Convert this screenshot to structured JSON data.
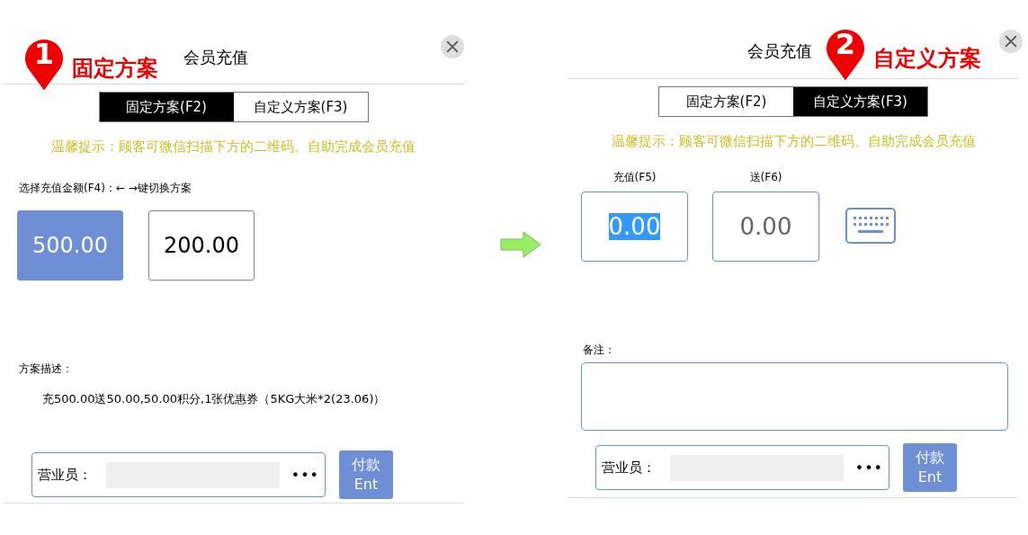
{
  "panels": [
    {
      "kind": "fixed",
      "title": "会员充值",
      "callout": {
        "number": "1",
        "label": "固定方案"
      },
      "tabs": [
        {
          "label": "固定方案(F2)",
          "selected": true
        },
        {
          "label": "自定义方案(F3)",
          "selected": false
        }
      ],
      "tip": "温馨提示：顾客可微信扫描下方的二维码。自助完成会员充值",
      "amount_label": "选择充值金额(F4)：← →键切换方案",
      "amounts": [
        {
          "value": "500.00",
          "selected": true
        },
        {
          "value": "200.00",
          "selected": false
        }
      ],
      "description_label": "方案描述：",
      "description": "充500.00送50.00,50.00积分,1张优惠券（5KG大米*2(23.06)）",
      "clerk_label": "营业员：",
      "more": "•••",
      "pay_button": "付款\nEnt"
    },
    {
      "kind": "custom",
      "title": "会员充值",
      "callout": {
        "number": "2",
        "label": "自定义方案"
      },
      "tabs": [
        {
          "label": "固定方案(F2)",
          "selected": false
        },
        {
          "label": "自定义方案(F3)",
          "selected": true
        }
      ],
      "tip": "温馨提示：顾客可微信扫描下方的二维码。自助完成会员充值",
      "fields": [
        {
          "label": "充值(F5)",
          "value": "0.00",
          "selected": true
        },
        {
          "label": "送(F6)",
          "value": "0.00",
          "selected": false
        }
      ],
      "remark_label": "备注：",
      "clerk_label": "营业员：",
      "more": "•••",
      "pay_button": "付款\nEnt"
    }
  ]
}
